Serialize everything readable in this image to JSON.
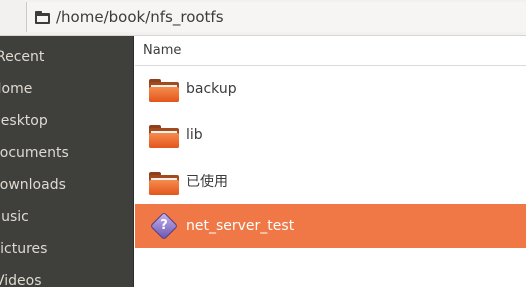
{
  "pathbar": {
    "path": "/home/book/nfs_rootfs"
  },
  "sidebar": {
    "items": [
      {
        "label": "Recent"
      },
      {
        "label": "Home"
      },
      {
        "label": "Desktop"
      },
      {
        "label": "Documents"
      },
      {
        "label": "Downloads"
      },
      {
        "label": "Music"
      },
      {
        "label": "Pictures"
      },
      {
        "label": "Videos"
      }
    ]
  },
  "file_list": {
    "column_header": "Name",
    "items": [
      {
        "name": "backup",
        "icon": "folder-icon"
      },
      {
        "name": "lib",
        "icon": "folder-icon"
      },
      {
        "name": "已使用",
        "icon": "folder-icon"
      },
      {
        "name": "net_server_test",
        "icon": "unknown-file-icon",
        "selected": true
      }
    ]
  },
  "colors": {
    "selection": "#f07746",
    "sidebar": "#3f3f3c",
    "folder": "#f07746"
  }
}
